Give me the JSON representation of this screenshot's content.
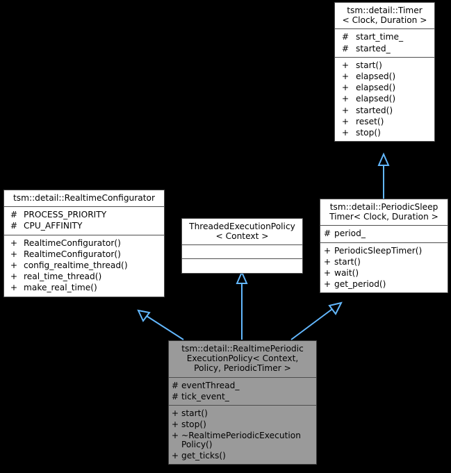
{
  "diagram": {
    "kind": "uml-class-inheritance-diagram",
    "background_color": "#000000",
    "edge_color": "#63b8ff",
    "box_fill": "#ffffff",
    "box_fill_shaded": "#9a9a9a",
    "box_border": "#4d4d4d"
  },
  "classes": {
    "timer": {
      "title_lines": [
        "tsm::detail::Timer",
        "< Clock, Duration >"
      ],
      "attributes": [
        {
          "visibility": "#",
          "name": "start_time_"
        },
        {
          "visibility": "#",
          "name": "started_"
        }
      ],
      "operations": [
        {
          "visibility": "+",
          "name": "start()"
        },
        {
          "visibility": "+",
          "name": "elapsed()"
        },
        {
          "visibility": "+",
          "name": "elapsed()"
        },
        {
          "visibility": "+",
          "name": "elapsed()"
        },
        {
          "visibility": "+",
          "name": "started()"
        },
        {
          "visibility": "+",
          "name": "reset()"
        },
        {
          "visibility": "+",
          "name": "stop()"
        }
      ]
    },
    "realtime_configurator": {
      "title_lines": [
        "tsm::detail::RealtimeConfigurator"
      ],
      "attributes": [
        {
          "visibility": "#",
          "name": "PROCESS_PRIORITY"
        },
        {
          "visibility": "#",
          "name": "CPU_AFFINITY"
        }
      ],
      "operations": [
        {
          "visibility": "+",
          "name": "RealtimeConfigurator()"
        },
        {
          "visibility": "+",
          "name": "RealtimeConfigurator()"
        },
        {
          "visibility": "+",
          "name": "config_realtime_thread()"
        },
        {
          "visibility": "+",
          "name": "real_time_thread()"
        },
        {
          "visibility": "+",
          "name": "make_real_time()"
        }
      ]
    },
    "threaded_execution_policy": {
      "title_lines": [
        "ThreadedExecutionPolicy",
        "< Context >"
      ],
      "attributes": [],
      "operations": []
    },
    "periodic_sleep_timer": {
      "title_lines": [
        "tsm::detail::PeriodicSleep",
        "Timer< Clock, Duration >"
      ],
      "attributes": [
        {
          "visibility": "#",
          "name": "period_"
        }
      ],
      "operations": [
        {
          "visibility": "+",
          "name": "PeriodicSleepTimer()"
        },
        {
          "visibility": "+",
          "name": "start()"
        },
        {
          "visibility": "+",
          "name": "wait()"
        },
        {
          "visibility": "+",
          "name": "get_period()"
        }
      ]
    },
    "realtime_periodic_execution_policy": {
      "title_lines": [
        "tsm::detail::RealtimePeriodic",
        "ExecutionPolicy< Context,",
        "Policy, PeriodicTimer >"
      ],
      "attributes": [
        {
          "visibility": "#",
          "name": "eventThread_"
        },
        {
          "visibility": "#",
          "name": "tick_event_"
        }
      ],
      "operations": [
        {
          "visibility": "+",
          "name": "start()"
        },
        {
          "visibility": "+",
          "name": "stop()"
        },
        {
          "visibility": "+",
          "name": "~RealtimePeriodicExecution Policy()"
        },
        {
          "visibility": "+",
          "name": "get_ticks()"
        }
      ]
    }
  },
  "relationships": [
    {
      "from": "periodic_sleep_timer",
      "to": "timer",
      "type": "inheritance"
    },
    {
      "from": "realtime_periodic_execution_policy",
      "to": "realtime_configurator",
      "type": "inheritance"
    },
    {
      "from": "realtime_periodic_execution_policy",
      "to": "threaded_execution_policy",
      "type": "inheritance"
    },
    {
      "from": "realtime_periodic_execution_policy",
      "to": "periodic_sleep_timer",
      "type": "inheritance"
    }
  ]
}
